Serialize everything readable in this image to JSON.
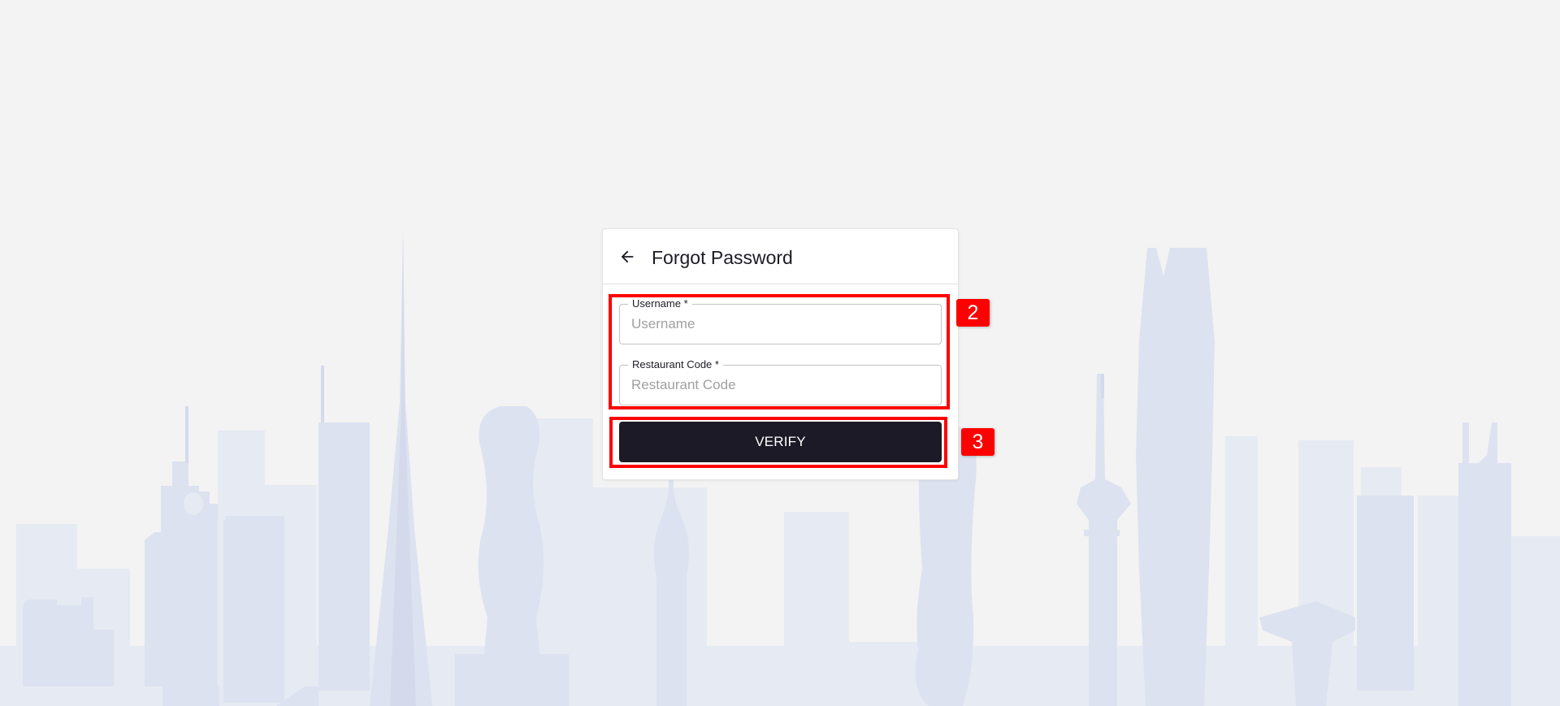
{
  "header": {
    "title": "Forgot Password",
    "back_icon": "arrow-left-icon"
  },
  "form": {
    "username": {
      "label": "Username *",
      "placeholder": "Username",
      "value": ""
    },
    "restaurant_code": {
      "label": "Restaurant Code *",
      "placeholder": "Restaurant Code",
      "value": ""
    },
    "verify_label": "VERIFY"
  },
  "annotations": [
    {
      "label": "2"
    },
    {
      "label": "3"
    }
  ],
  "colors": {
    "background": "#f3f3f3",
    "skyline": "#dde2f0",
    "button": "#1c1a26",
    "annotation": "#ff0000"
  }
}
